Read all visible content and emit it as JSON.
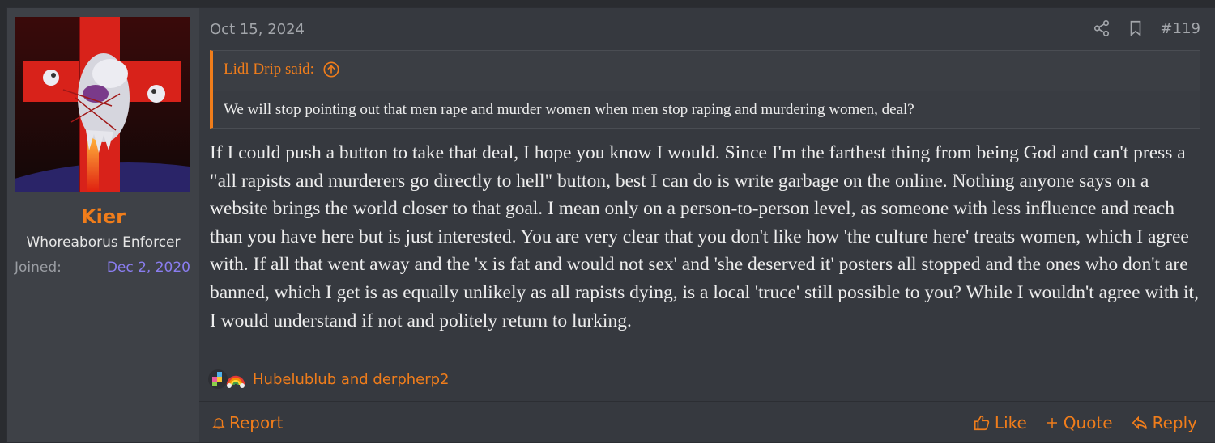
{
  "user": {
    "name": "Kier",
    "title": "Whoreaborus Enforcer",
    "joined_label": "Joined:",
    "joined_date": "Dec 2, 2020"
  },
  "post": {
    "date": "Oct 15, 2024",
    "number": "#119"
  },
  "quote": {
    "author_said": "Lidl Drip said:",
    "text": "We will stop pointing out that men rape and murder women when men stop raping and murdering women, deal?"
  },
  "message": {
    "text": "If I could push a button to take that deal, I hope you know I would. Since I'm the farthest thing from being God and can't press a \"all rapists and murderers go directly to hell\" button, best I can do is write garbage on the online. Nothing anyone says on a website brings the world closer to that goal. I mean only on a person-to-person level, as someone with less influence and reach than you have here but is just interested. You are very clear that you don't like how 'the culture here' treats women, which I agree with. If all that went away and the 'x is fat and would not sex' and 'she deserved it' posters all stopped and the ones who don't are banned, which I get is as equally unlikely as all rapists dying, is a local 'truce' still possible to you? While I wouldn't agree with it, I would understand if not and politely return to lurking."
  },
  "reactions": {
    "text": "Hubelublub and derpherp2",
    "icons": [
      "puzzle-icon",
      "rainbow-icon"
    ]
  },
  "footer": {
    "report": "Report",
    "like": "Like",
    "quote": "Quote",
    "reply": "Reply"
  },
  "colors": {
    "accent": "#f07d1b",
    "joined_date": "#8a7df0",
    "background": "#36393f",
    "sidebar": "#3e4147"
  }
}
